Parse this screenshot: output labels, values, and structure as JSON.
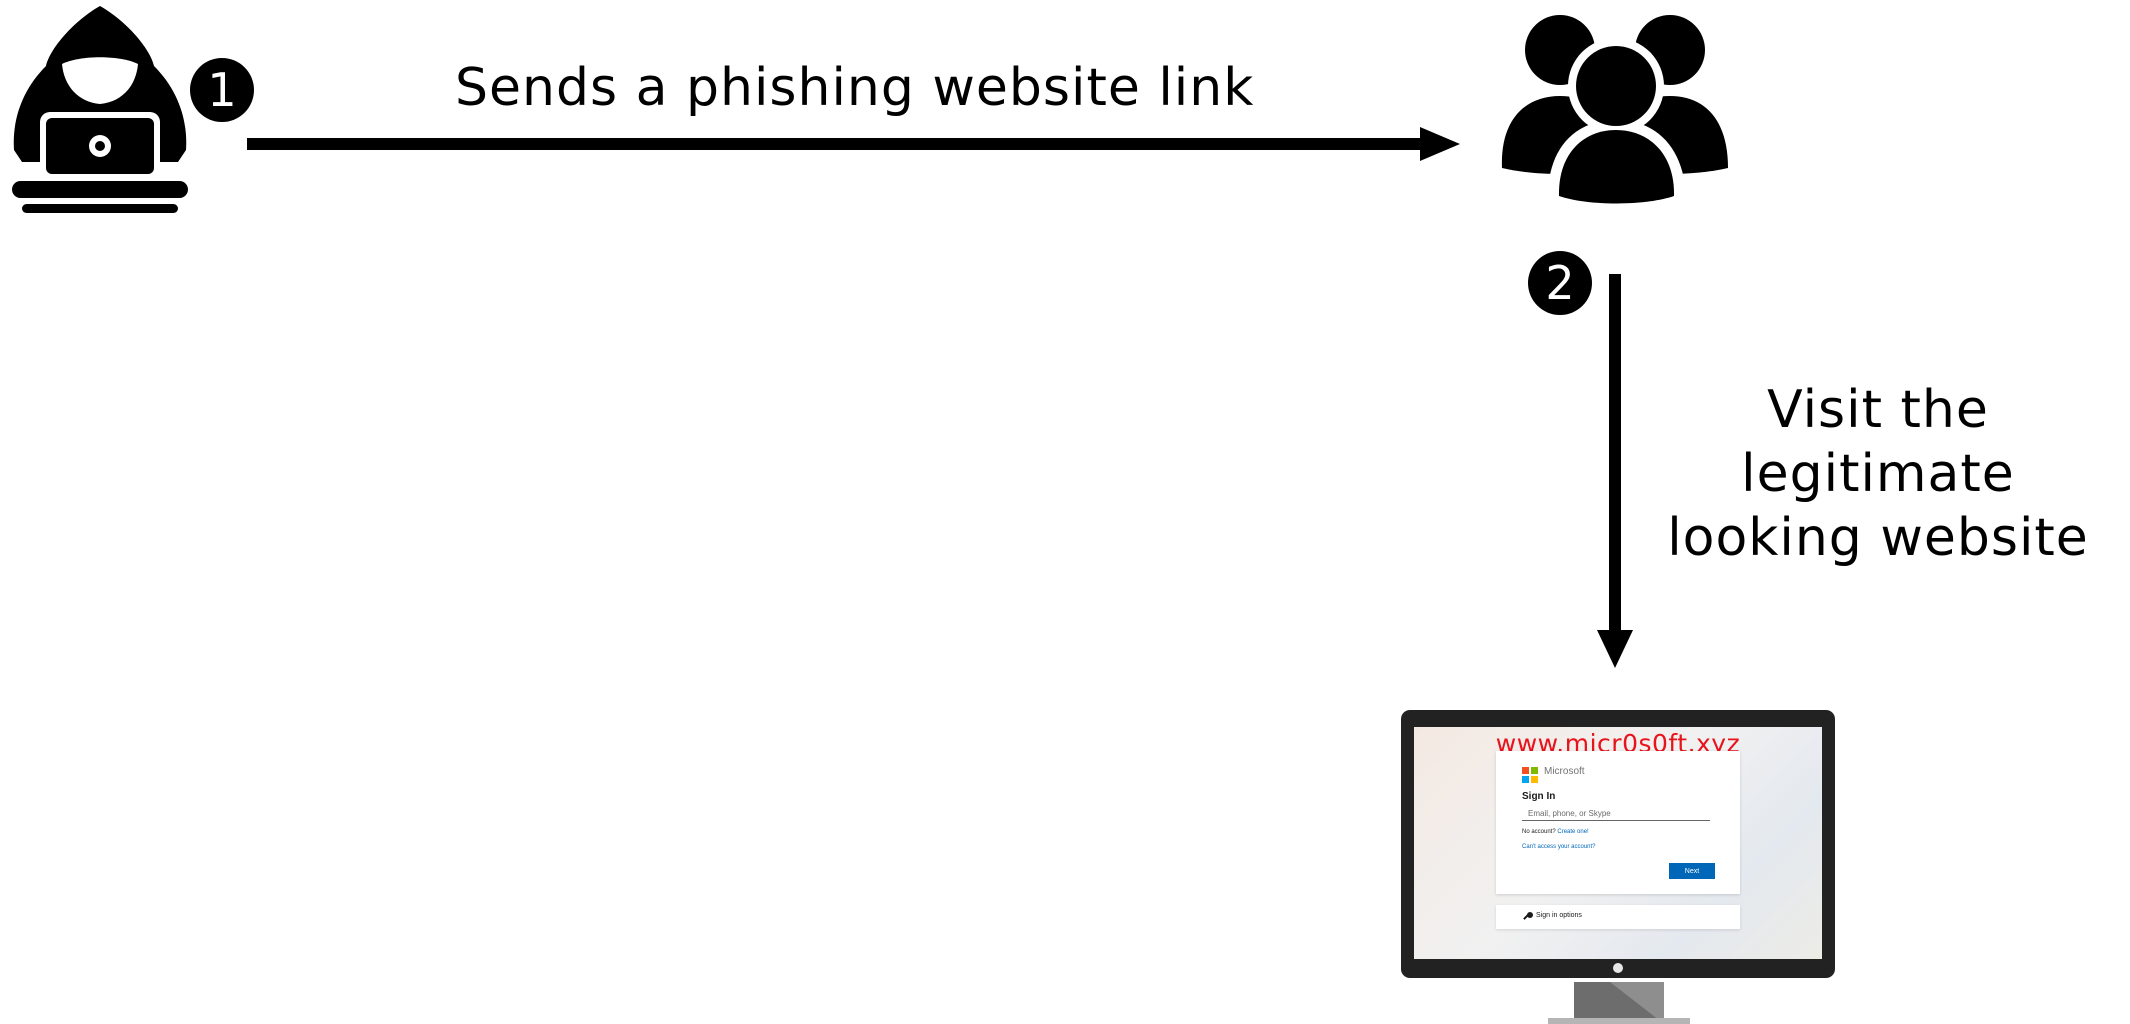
{
  "steps": [
    {
      "number": "1",
      "label": "Sends a phishing website link"
    },
    {
      "number": "2",
      "label_line1": "Visit the legitimate",
      "label_line2": "looking website"
    }
  ],
  "icons": {
    "attacker": "hooded-hacker-with-laptop-icon",
    "victims": "user-group-icon",
    "device": "desktop-monitor-icon"
  },
  "fake_site": {
    "url": "www.micr0s0ft.xyz",
    "brand": "Microsoft",
    "title": "Sign In",
    "email_placeholder": "Email, phone, or Skype",
    "no_account_text": "No account?",
    "create_link": "Create one!",
    "cant_access": "Can't access your account?",
    "next_button": "Next",
    "sign_in_options": "Sign in options"
  },
  "colors": {
    "foreground": "#000000",
    "url": "#e8131b",
    "ms_blue": "#0067b8",
    "ms_red": "#f25022",
    "ms_green": "#7fba00",
    "ms_blue_square": "#00a4ef",
    "ms_yellow": "#ffb900"
  }
}
